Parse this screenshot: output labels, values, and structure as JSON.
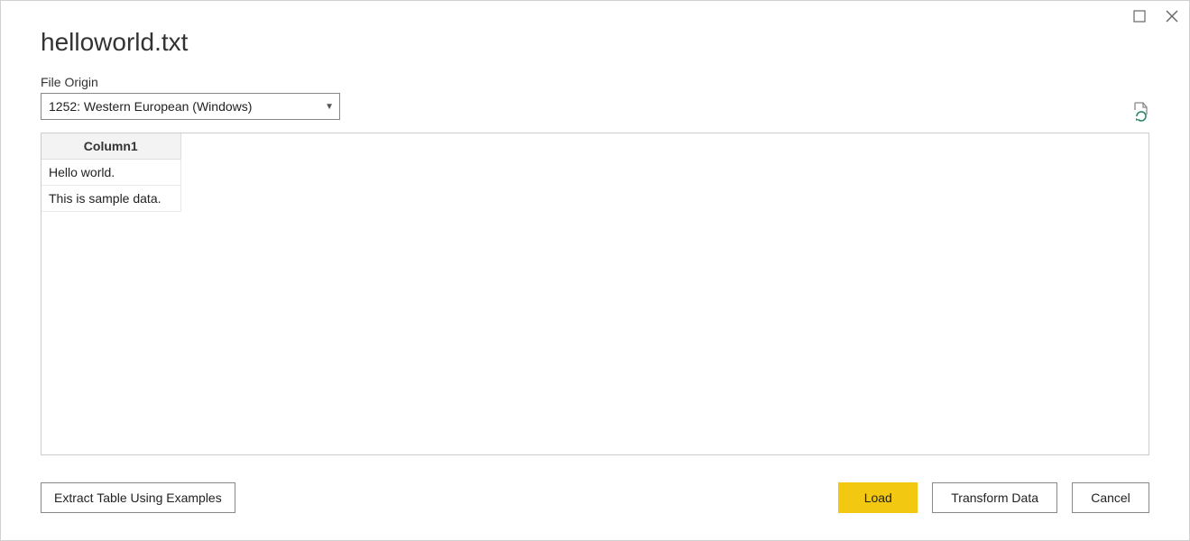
{
  "title": "helloworld.txt",
  "fileOrigin": {
    "label": "File Origin",
    "selected": "1252: Western European (Windows)"
  },
  "table": {
    "columns": [
      "Column1"
    ],
    "rows": [
      [
        "Hello world."
      ],
      [
        "This is sample data."
      ]
    ]
  },
  "buttons": {
    "extract": "Extract Table Using Examples",
    "load": "Load",
    "transform": "Transform Data",
    "cancel": "Cancel"
  }
}
